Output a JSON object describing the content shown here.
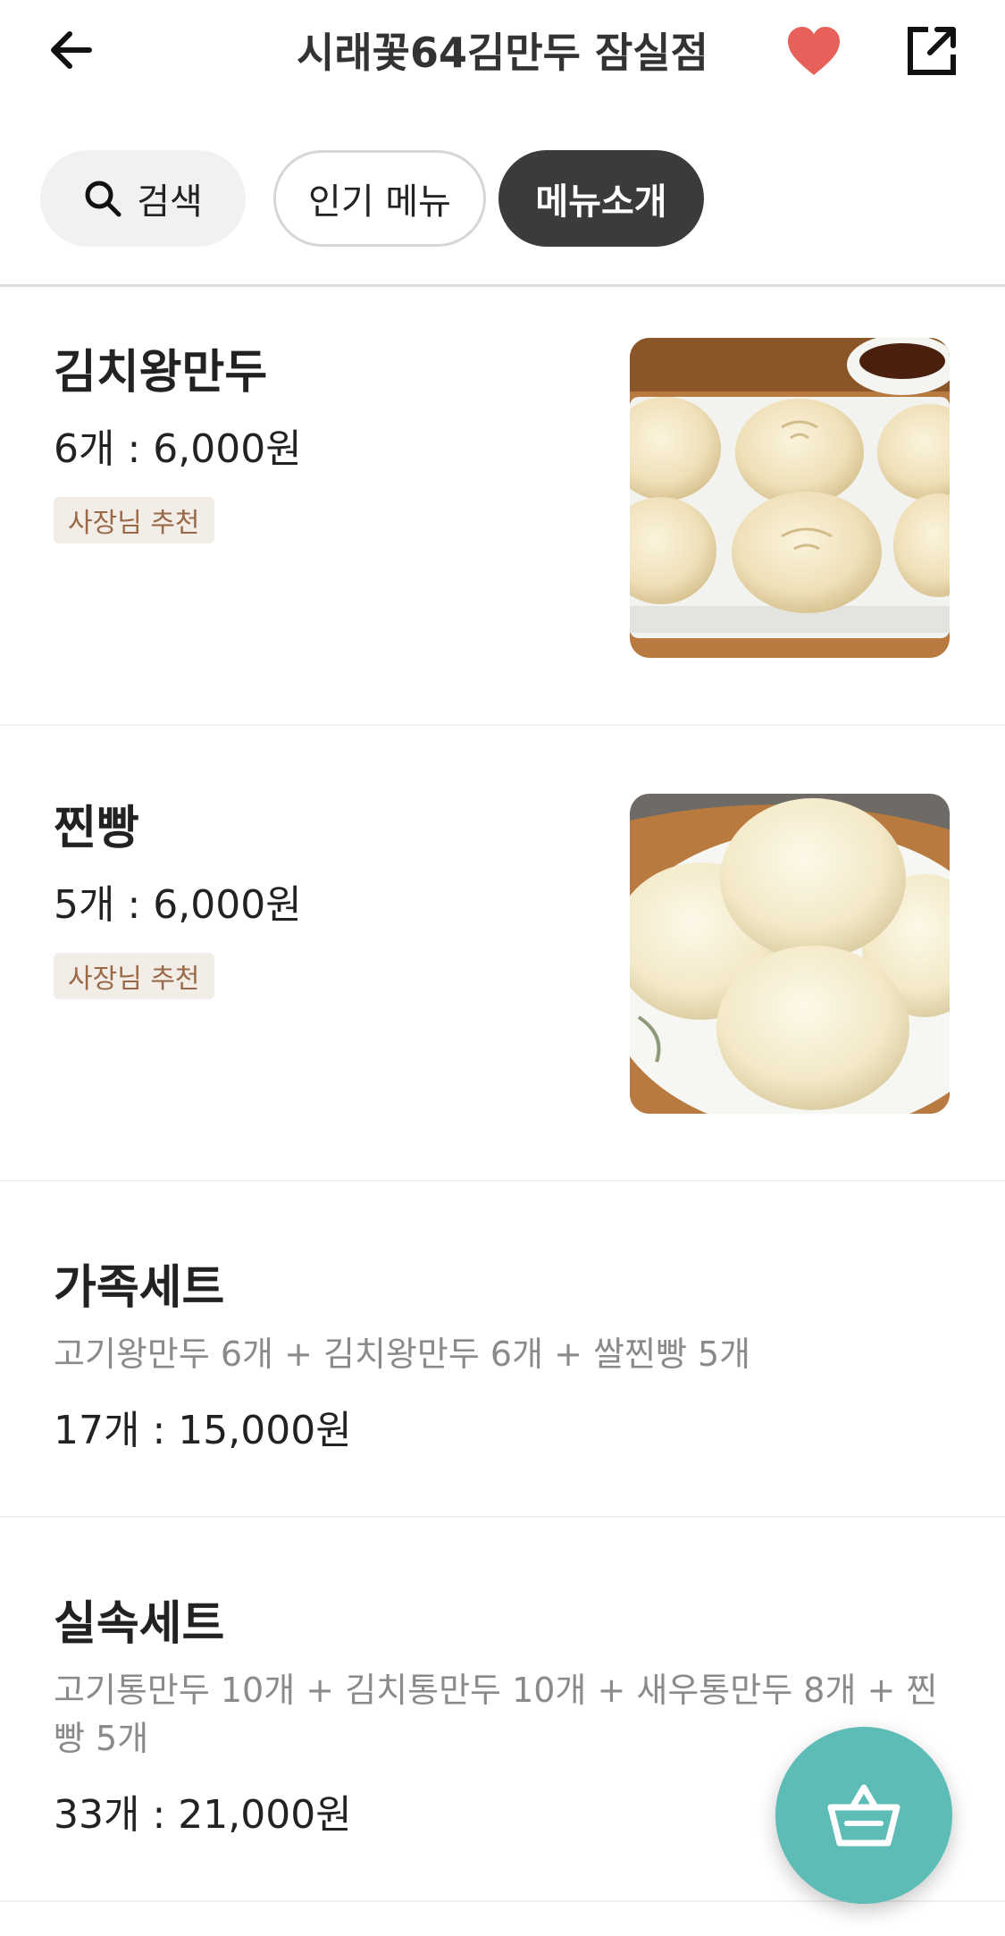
{
  "header": {
    "title": "시래꽃64김만두 잠실점",
    "icons": {
      "back": "arrow-left-icon",
      "favorite": "heart-icon",
      "share": "share-icon"
    },
    "favorite_color": "#e8605a"
  },
  "tabs": {
    "search_label": "검색",
    "popular_label": "인기 메뉴",
    "menu_intro_label": "메뉴소개",
    "active_tab": "메뉴소개"
  },
  "menu": [
    {
      "name": "김치왕만두",
      "price": "6개 : 6,000원",
      "badge": "사장님 추천"
    },
    {
      "name": "찐빵",
      "price": "5개 : 6,000원",
      "badge": "사장님 추천"
    },
    {
      "name": "가족세트",
      "description": "고기왕만두 6개 + 김치왕만두 6개 + 쌀찐빵 5개",
      "price": "17개 : 15,000원"
    },
    {
      "name": "실속세트",
      "description": "고기통만두 10개 + 김치통만두 10개 + 새우통만두 8개 + 찐빵 5개",
      "price": "33개 : 21,000원"
    }
  ],
  "cart": {
    "icon": "shopping-basket-icon",
    "color": "#5ebcb6"
  }
}
